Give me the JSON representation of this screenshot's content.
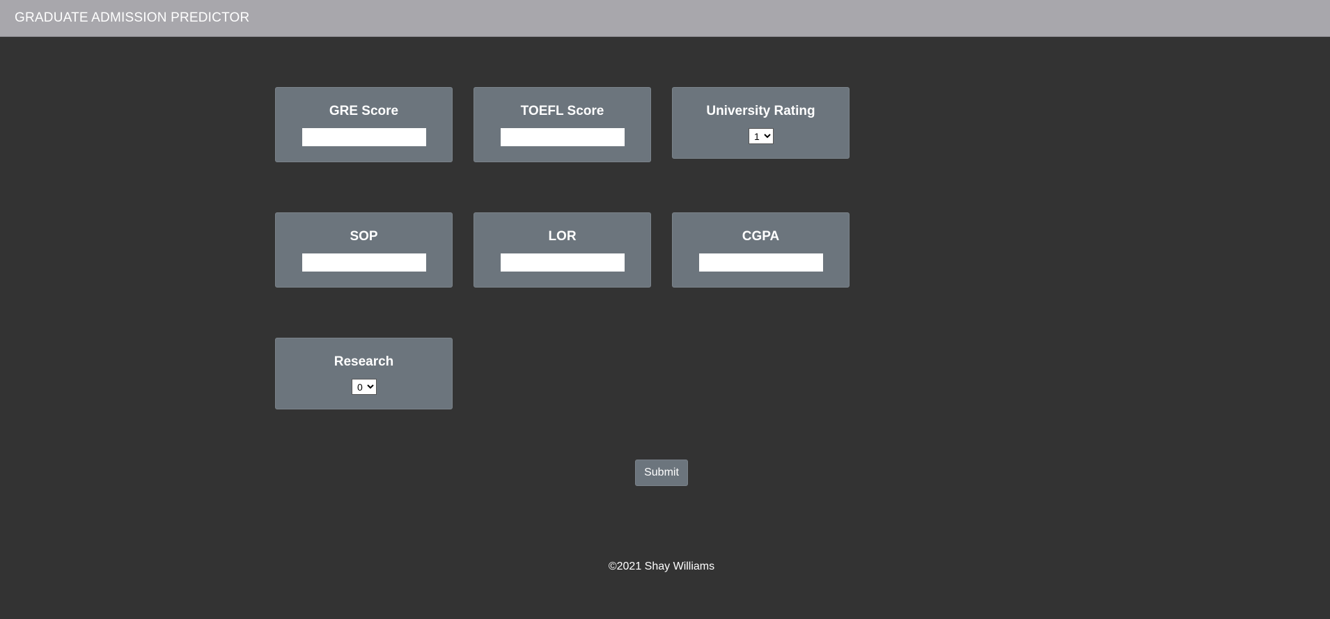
{
  "header": {
    "brand": "GRADUATE ADMISSION PREDICTOR"
  },
  "form": {
    "fields": {
      "gre": {
        "label": "GRE Score",
        "value": ""
      },
      "toefl": {
        "label": "TOEFL Score",
        "value": ""
      },
      "university_rating": {
        "label": "University Rating",
        "selected": "1"
      },
      "sop": {
        "label": "SOP",
        "value": ""
      },
      "lor": {
        "label": "LOR",
        "value": ""
      },
      "cgpa": {
        "label": "CGPA",
        "value": ""
      },
      "research": {
        "label": "Research",
        "selected": "0"
      }
    },
    "submit_label": "Submit"
  },
  "footer": {
    "text": "©2021 Shay Williams"
  },
  "colors": {
    "page_background": "#333333",
    "header_background": "#a8a7ac",
    "card_background": "#6c757d",
    "text": "#ffffff"
  }
}
